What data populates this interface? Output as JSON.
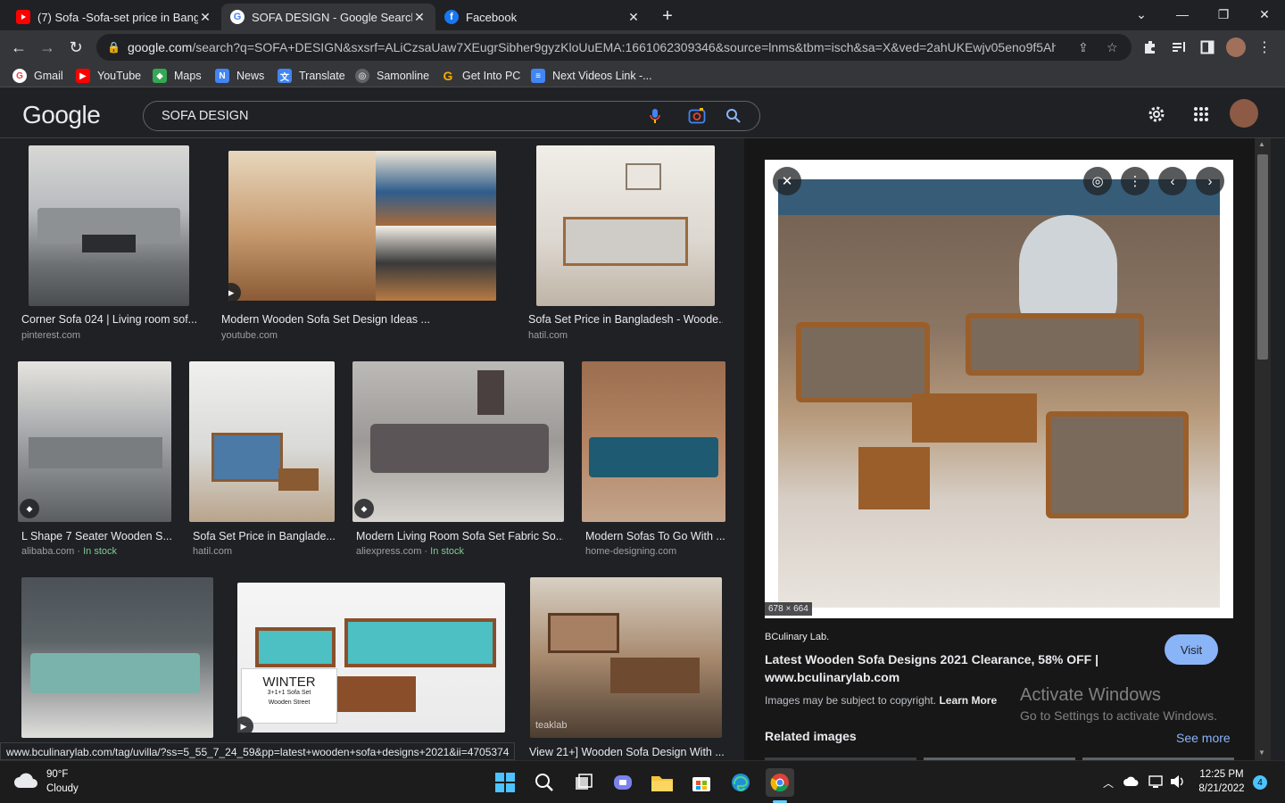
{
  "tabs": [
    {
      "title": "(7) Sofa -Sofa-set price in Bangla",
      "favicon": "youtube-icon",
      "active": false
    },
    {
      "title": "SOFA DESIGN - Google Search",
      "favicon": "google-icon",
      "active": true
    },
    {
      "title": "Facebook",
      "favicon": "facebook-icon",
      "active": false
    }
  ],
  "toolbar": {
    "url_host": "google.com",
    "url_rest": "/search?q=SOFA+DESIGN&sxsrf=ALiCzsaUaw7XEugrSibher9gyzKloUuEMA:1661062309346&source=lnms&tbm=isch&sa=X&ved=2ahUKEwjv05eno9f5AhXjT..."
  },
  "bookmarks": [
    {
      "label": "Gmail",
      "icon": "google-icon",
      "color": "#ea4335"
    },
    {
      "label": "YouTube",
      "icon": "youtube-icon",
      "color": "#ff0000"
    },
    {
      "label": "Maps",
      "icon": "maps-icon",
      "color": "#34a853"
    },
    {
      "label": "News",
      "icon": "news-icon",
      "color": "#4285f4"
    },
    {
      "label": "Translate",
      "icon": "translate-icon",
      "color": "#4285f4"
    },
    {
      "label": "Samonline",
      "icon": "globe-icon",
      "color": "#5f6368"
    },
    {
      "label": "Get Into PC",
      "icon": "g-icon",
      "color": "#f9ab00"
    },
    {
      "label": "Next Videos Link -...",
      "icon": "doc-icon",
      "color": "#4285f4"
    }
  ],
  "google": {
    "logo": "Google",
    "query": "SOFA DESIGN"
  },
  "results": [
    {
      "caption": "Corner Sofa 024 | Living room sof...",
      "source": "pinterest.com",
      "stock": ""
    },
    {
      "caption": "Modern Wooden Sofa Set Design Ideas ...",
      "source": "youtube.com",
      "stock": ""
    },
    {
      "caption": "Sofa Set Price in Bangladesh - Woode...",
      "source": "hatil.com",
      "stock": ""
    },
    {
      "caption": "L Shape 7 Seater Wooden S...",
      "source": "alibaba.com",
      "stock": "In stock"
    },
    {
      "caption": "Sofa Set Price in Banglade...",
      "source": "hatil.com",
      "stock": ""
    },
    {
      "caption": "Modern Living Room Sofa Set Fabric So...",
      "source": "aliexpress.com",
      "stock": "In stock"
    },
    {
      "caption": "Modern Sofas To Go With ...",
      "source": "home-designing.com",
      "stock": ""
    },
    {
      "caption": "",
      "source": "",
      "stock": ""
    },
    {
      "caption": "",
      "source": "",
      "stock": ""
    },
    {
      "caption": "View 21+] Wooden Sofa Design With ...",
      "source": "",
      "stock": ""
    }
  ],
  "image_text": {
    "winter_title": "WINTER",
    "winter_sub": "3+1+1 Sofa Set",
    "winter_brand": "Wooden Street",
    "teaklab": "teaklab"
  },
  "panel": {
    "dimensions": "678 × 664",
    "site": "BCulinary Lab.",
    "title": "Latest Wooden Sofa Designs 2021 Clearance, 58% OFF | www.bculinarylab.com",
    "visit": "Visit",
    "copyright": "Images may be subject to copyright.",
    "learn_more": "Learn More",
    "related": "Related images",
    "see_more": "See more"
  },
  "status_url": "www.bculinarylab.com/tag/uvilla/?ss=5_55_7_24_59&pp=latest+wooden+sofa+designs+2021&ii=4705374",
  "watermark": {
    "line1": "Activate Windows",
    "line2": "Go to Settings to activate Windows."
  },
  "taskbar": {
    "temp": "90°F",
    "weather": "Cloudy",
    "time": "12:25 PM",
    "date": "8/21/2022",
    "notifications": "4"
  }
}
